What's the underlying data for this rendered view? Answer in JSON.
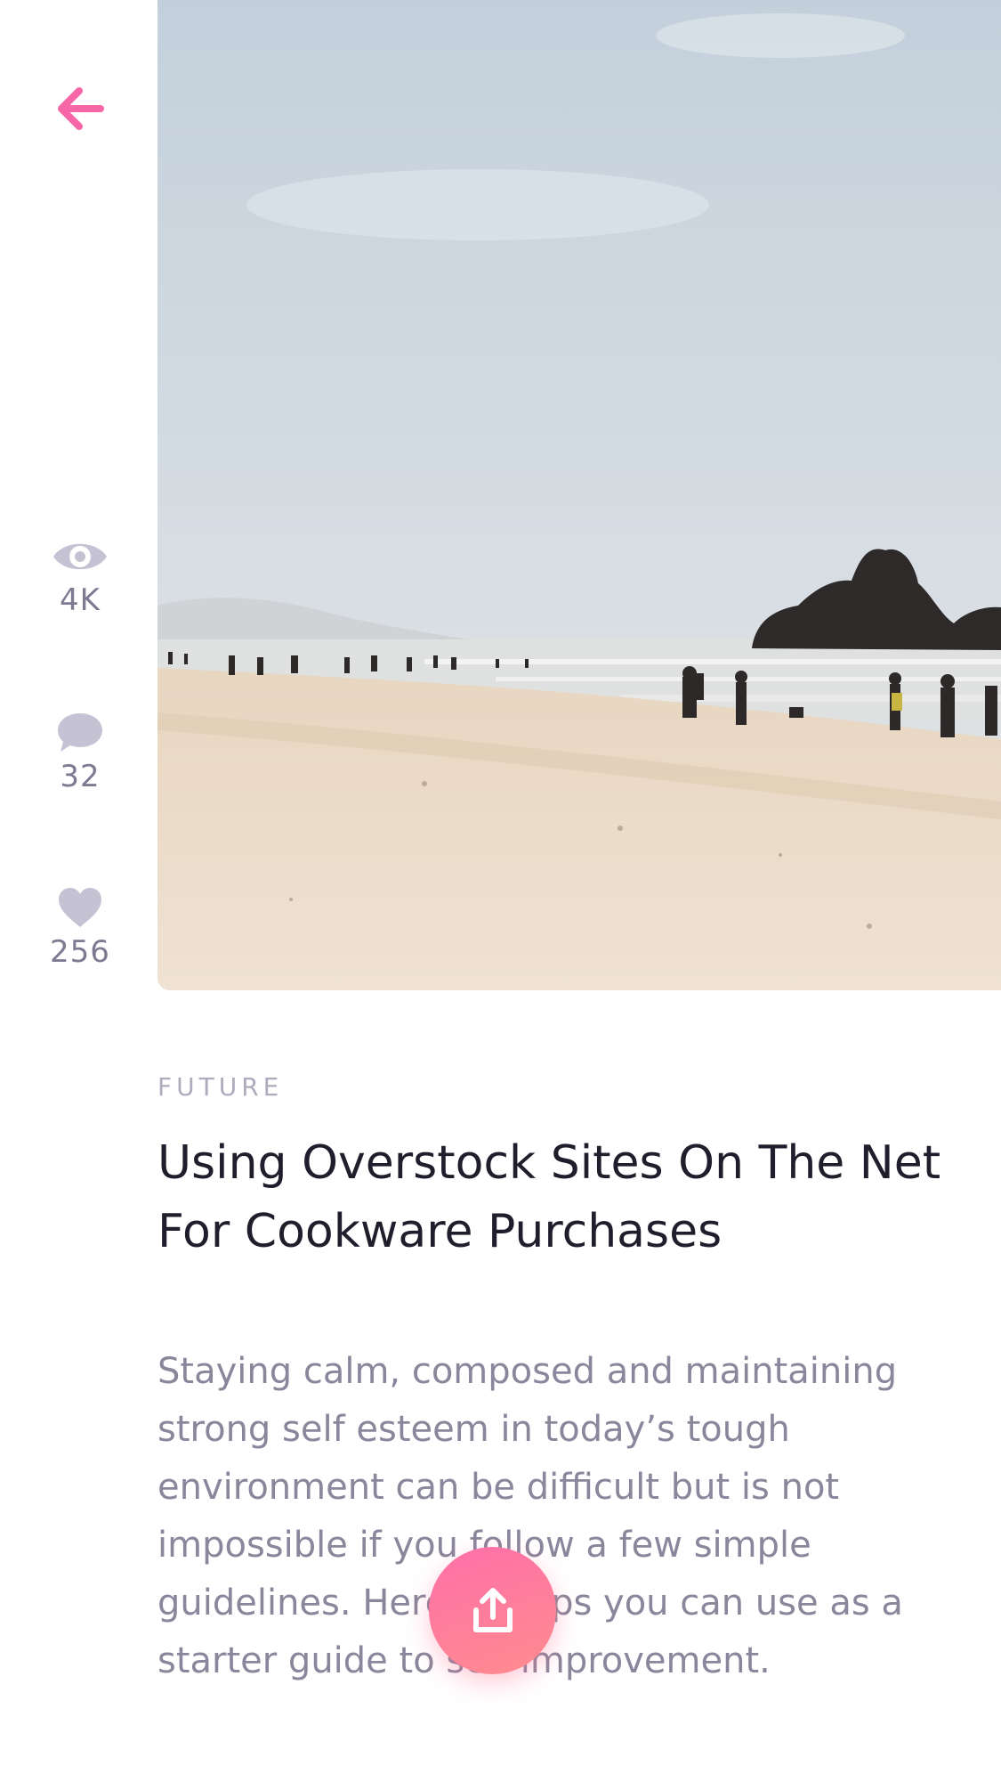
{
  "nav": {
    "back_icon": "arrow-left-icon",
    "accent_color": "#f766a7"
  },
  "stats": {
    "views": {
      "icon": "eye-icon",
      "count": "4K"
    },
    "comments": {
      "icon": "comment-icon",
      "count": "32"
    },
    "likes": {
      "icon": "heart-icon",
      "count": "256"
    }
  },
  "hero_image": {
    "subject": "beach-photo"
  },
  "article": {
    "category": "FUTURE",
    "title": "Using Overstock Sites On The Net For Cookware Purchases",
    "body": "Staying calm, composed and maintaining strong self esteem in today’s tough environment can be difficult but is not impossible if you follow a few simple guidelines. Here are tips you can use as a starter guide to self improvement."
  },
  "share": {
    "icon": "share-upload-icon"
  }
}
